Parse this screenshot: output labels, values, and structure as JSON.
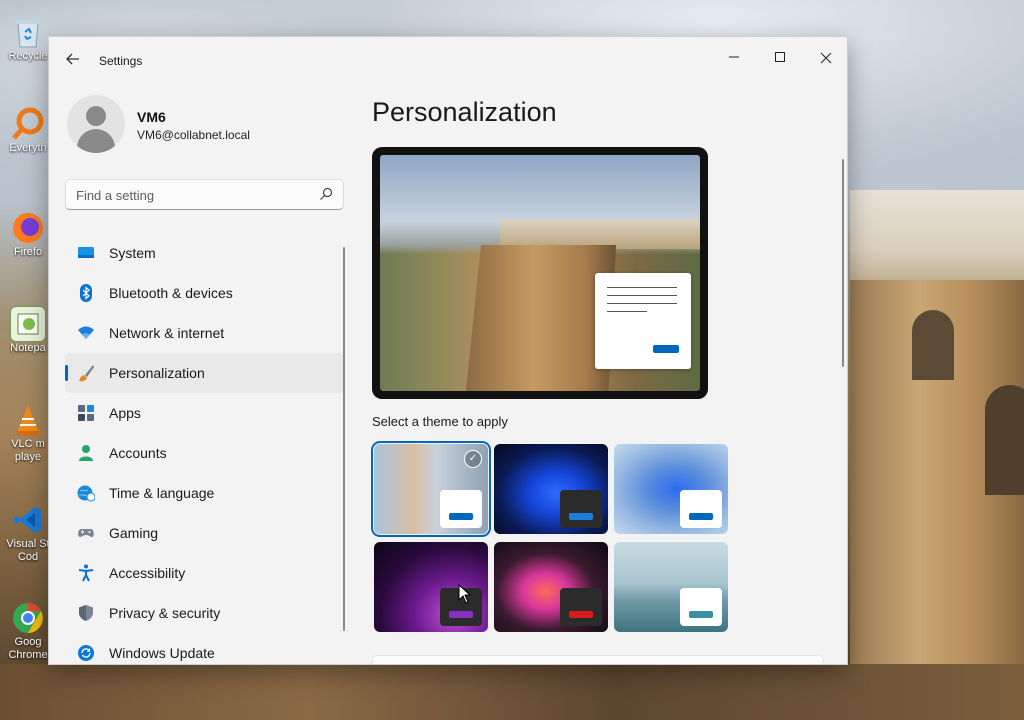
{
  "desktop": {
    "icons": [
      {
        "label": "Recycle",
        "icon": "recycle-bin-icon"
      },
      {
        "label": "Everyth",
        "icon": "everything-search-icon"
      },
      {
        "label": "Firefo",
        "icon": "firefox-icon"
      },
      {
        "label": "Notepa",
        "icon": "notepad-plus-icon"
      },
      {
        "label": "VLC m",
        "label2": "playe",
        "icon": "vlc-icon"
      },
      {
        "label": "Visual St",
        "label2": "Cod",
        "icon": "vscode-icon"
      },
      {
        "label": "Goog",
        "label2": "Chrome",
        "icon": "chrome-icon"
      }
    ]
  },
  "window": {
    "title": "Settings",
    "controls": {
      "minimize": "–",
      "maximize": "☐",
      "close": "✕"
    }
  },
  "profile": {
    "name": "VM6",
    "email": "VM6@collabnet.local"
  },
  "search": {
    "placeholder": "Find a setting"
  },
  "nav": {
    "items": [
      {
        "label": "System",
        "icon": "system-monitor-icon",
        "color": "#0a84d8"
      },
      {
        "label": "Bluetooth & devices",
        "icon": "bluetooth-icon",
        "color": "#0a74d4"
      },
      {
        "label": "Network & internet",
        "icon": "wifi-icon",
        "color": "#1e7de0"
      },
      {
        "label": "Personalization",
        "icon": "paintbrush-icon",
        "color": "#e08a2e",
        "active": true
      },
      {
        "label": "Apps",
        "icon": "apps-icon",
        "color": "#4a5a6e"
      },
      {
        "label": "Accounts",
        "icon": "accounts-icon",
        "color": "#20a86b"
      },
      {
        "label": "Time & language",
        "icon": "globe-clock-icon",
        "color": "#1a8ad8"
      },
      {
        "label": "Gaming",
        "icon": "gamepad-icon",
        "color": "#7a8594"
      },
      {
        "label": "Accessibility",
        "icon": "accessibility-icon",
        "color": "#0a6fd0"
      },
      {
        "label": "Privacy & security",
        "icon": "shield-icon",
        "color": "#6b7582"
      },
      {
        "label": "Windows Update",
        "icon": "windows-update-icon",
        "color": "#0a78d8"
      }
    ]
  },
  "content": {
    "title": "Personalization",
    "theme_label": "Select a theme to apply",
    "themes": [
      {
        "name": "theme-windows-spotlight",
        "selected": true,
        "mini_bg": "#ffffff",
        "bar": "#0067c0"
      },
      {
        "name": "theme-windows-dark",
        "selected": false,
        "mini_bg": "#2b2b2b",
        "bar": "#1a7fd8"
      },
      {
        "name": "theme-windows-light",
        "selected": false,
        "mini_bg": "#ffffff",
        "bar": "#0067c0"
      },
      {
        "name": "theme-glow",
        "selected": false,
        "mini_bg": "#2b2b2b",
        "bar": "#8a2ec0"
      },
      {
        "name": "theme-captured-motion",
        "selected": false,
        "mini_bg": "#2b2b2b",
        "bar": "#d81b1b"
      },
      {
        "name": "theme-flow",
        "selected": false,
        "mini_bg": "#ffffff",
        "bar": "#3a8fa6"
      }
    ]
  },
  "colors": {
    "accent": "#0067c0",
    "window_bg": "#f3f3f3"
  }
}
